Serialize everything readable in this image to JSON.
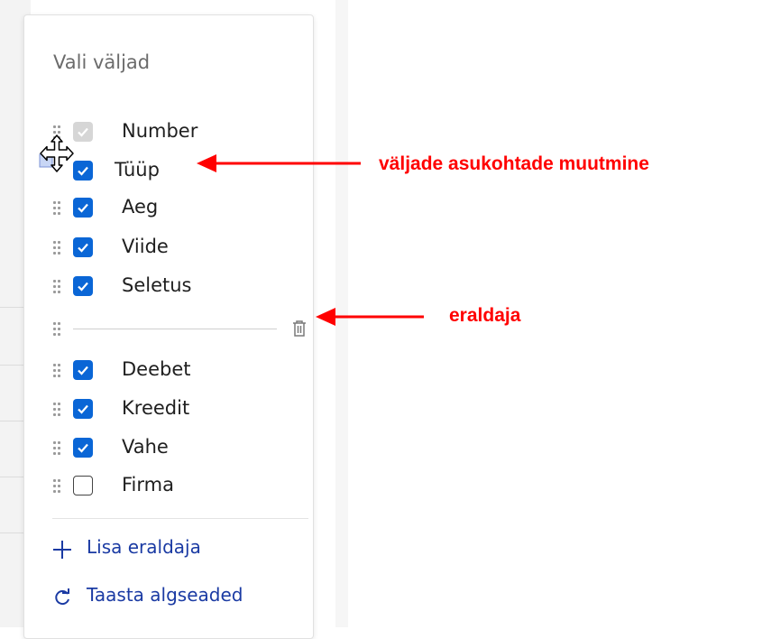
{
  "panel": {
    "title": "Vali väljad",
    "fields": [
      {
        "label": "Number",
        "state": "disabled"
      },
      {
        "label": "Tüüp",
        "state": "checked"
      },
      {
        "label": "Aeg",
        "state": "checked"
      },
      {
        "label": "Viide",
        "state": "checked"
      },
      {
        "label": "Seletus",
        "state": "checked"
      },
      {
        "label": "Deebet",
        "state": "checked"
      },
      {
        "label": "Kreedit",
        "state": "checked"
      },
      {
        "label": "Vahe",
        "state": "checked"
      },
      {
        "label": "Firma",
        "state": "unchecked"
      }
    ],
    "separator_icon": "trash-icon",
    "add_separator": "Lisa eraldaja",
    "restore_defaults": "Taasta algseaded"
  },
  "annotations": {
    "move_fields": "väljade asukohtade muutmine",
    "separator": "eraldaja"
  },
  "colors": {
    "checkbox": "#0a66d6",
    "link": "#1a3aa3",
    "annotation": "#ff0000"
  }
}
